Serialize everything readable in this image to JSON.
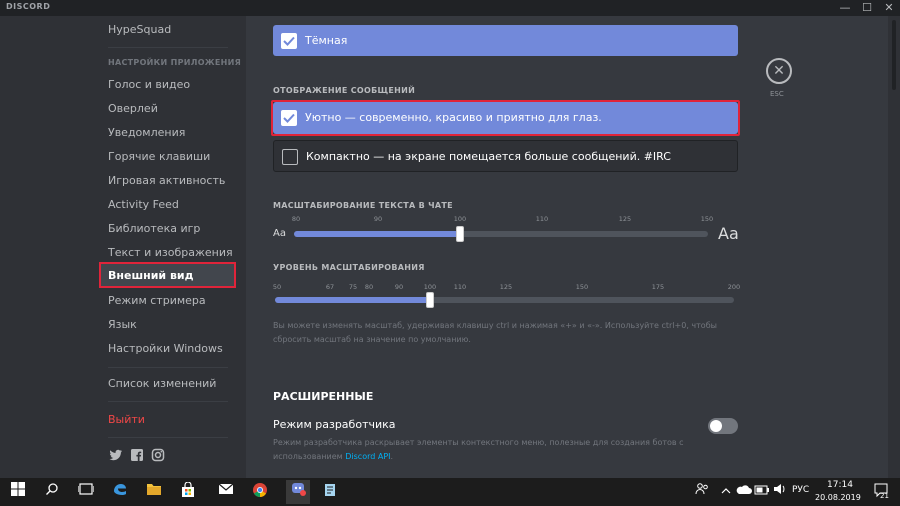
{
  "titlebar": {
    "brand": "DISCORD",
    "minimize": "—",
    "maximize": "☐",
    "close": "✕"
  },
  "sidebar": {
    "top_item": "HypeSquad",
    "section_header": "НАСТРОЙКИ ПРИЛОЖЕНИЯ",
    "items": [
      "Голос и видео",
      "Оверлей",
      "Уведомления",
      "Горячие клавиши",
      "Игровая активность",
      "Activity Feed",
      "Библиотека игр",
      "Текст и изображения"
    ],
    "active_item": "Внешний вид",
    "items2": [
      "Режим стримера",
      "Язык",
      "Настройки Windows"
    ],
    "changelog": "Список изменений",
    "logout": "Выйти",
    "social_icons": [
      "twitter-icon",
      "facebook-icon",
      "instagram-icon"
    ]
  },
  "theme_option": {
    "label": "Тёмная",
    "checked": true
  },
  "message_display": {
    "header": "ОТОБРАЖЕНИЕ СООБЩЕНИЙ",
    "options": [
      {
        "label": "Уютно — современно, красиво и приятно для глаз.",
        "checked": true
      },
      {
        "label": "Компактно — на экране помещается больше сообщений. #IRC",
        "checked": false
      }
    ]
  },
  "chat_font_scaling": {
    "header": "МАСШТАБИРОВАНИЕ ТЕКСТА В ЧАТЕ",
    "ticks": [
      "80",
      "90",
      "100",
      "110",
      "125",
      "150"
    ],
    "value": 100,
    "small_label": "Aa",
    "big_label": "Aa"
  },
  "zoom_level": {
    "header": "УРОВЕНЬ МАСШТАБИРОВАНИЯ",
    "ticks": [
      "50",
      "67",
      "75",
      "80",
      "90",
      "100",
      "110",
      "125",
      "150",
      "175",
      "200"
    ],
    "value": 100
  },
  "zoom_hint": "Вы можете изменять масштаб, удерживая клавишу ctrl и нажимая «+» и «-». Используйте ctrl+0, чтобы сбросить масштаб на значение по умолчанию.",
  "advanced": {
    "header": "РАСШИРЕННЫЕ",
    "dev_mode_label": "Режим разработчика",
    "dev_mode_enabled": false,
    "dev_mode_hint_prefix": "Режим разработчика раскрывает элементы контекстного меню, полезные для создания ботов с использованием",
    "dev_mode_link": "Discord API",
    "dev_mode_hint_suffix": "."
  },
  "close_button": {
    "glyph": "✕",
    "label": "ESC"
  },
  "taskbar": {
    "language": "РУС",
    "time": "17:14",
    "date": "20.08.2019",
    "notifications": "21"
  },
  "colors": {
    "accent": "#7289da",
    "highlight": "#e0243a",
    "danger": "#f04747",
    "link": "#00b0f4"
  }
}
